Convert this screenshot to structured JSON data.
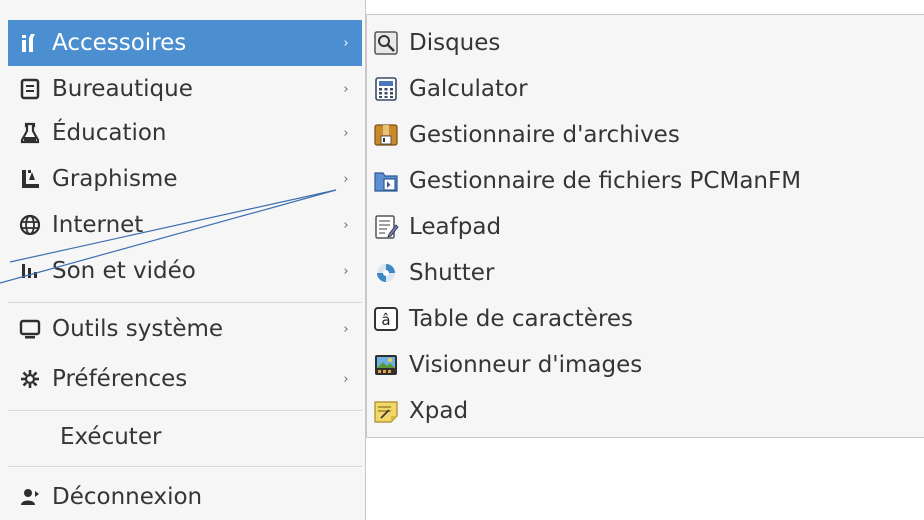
{
  "main_menu": {
    "items": [
      {
        "label": "Accessoires",
        "icon": "accessories-icon",
        "has_submenu": true,
        "active": true
      },
      {
        "label": "Bureautique",
        "icon": "office-icon",
        "has_submenu": true
      },
      {
        "label": "Éducation",
        "icon": "education-icon",
        "has_submenu": true
      },
      {
        "label": "Graphisme",
        "icon": "graphics-icon",
        "has_submenu": true
      },
      {
        "label": "Internet",
        "icon": "internet-icon",
        "has_submenu": true
      },
      {
        "label": "Son et vidéo",
        "icon": "multimedia-icon",
        "has_submenu": true
      },
      {
        "label": "Outils système",
        "icon": "system-tools-icon",
        "has_submenu": true
      },
      {
        "label": "Préférences",
        "icon": "preferences-icon",
        "has_submenu": true
      },
      {
        "label": "Exécuter",
        "icon": "",
        "has_submenu": false
      },
      {
        "label": "Déconnexion",
        "icon": "logout-icon",
        "has_submenu": false
      }
    ]
  },
  "sub_menu": {
    "items": [
      {
        "label": "Disques",
        "icon": "disks-icon"
      },
      {
        "label": "Galculator",
        "icon": "calculator-icon"
      },
      {
        "label": "Gestionnaire d'archives",
        "icon": "archive-manager-icon"
      },
      {
        "label": "Gestionnaire de fichiers PCManFM",
        "icon": "file-manager-icon"
      },
      {
        "label": "Leafpad",
        "icon": "text-editor-icon"
      },
      {
        "label": "Shutter",
        "icon": "screenshot-icon"
      },
      {
        "label": "Table de caractères",
        "icon": "character-map-icon"
      },
      {
        "label": "Visionneur d'images",
        "icon": "image-viewer-icon"
      },
      {
        "label": "Xpad",
        "icon": "notes-icon"
      }
    ]
  },
  "colors": {
    "active_bg": "#4b8fd0",
    "menu_bg": "#f6f6f6",
    "text": "#353535",
    "arrow": "#6a6a6a"
  },
  "arrow_glyph": "›"
}
